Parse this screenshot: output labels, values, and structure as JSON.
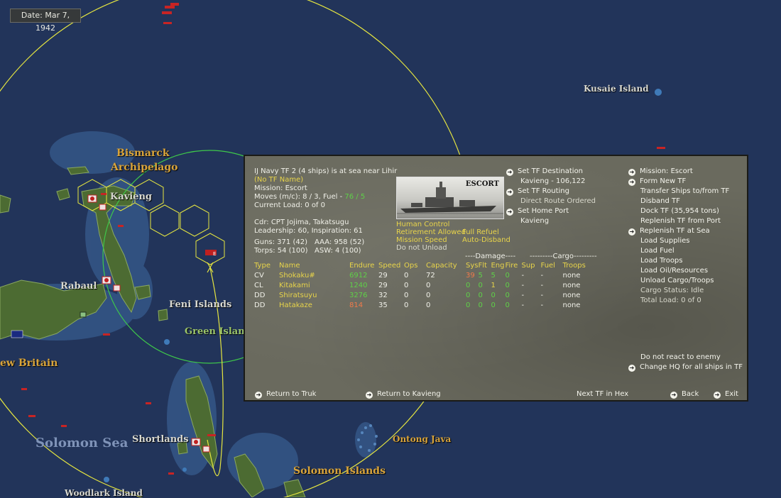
{
  "date": "Date: Mar 7, 1942",
  "map_labels": {
    "bismarck1": "Bismarck",
    "bismarck2": "Archipelago",
    "kavieng": "Kavieng",
    "rabaul": "Rabaul",
    "feni": "Feni Islands",
    "green_island": "Green Island",
    "new_britain": "ew Britain",
    "solomon_sea": "Solomon Sea",
    "shortlands": "Shortlands",
    "ontong_java": "Ontong Java",
    "solomon_islands": "Solomon Islands",
    "woodlark": "Woodlark Island",
    "kusaie": "Kusaie Island"
  },
  "tf": {
    "header": "IJ Navy TF 2 (4 ships) is at sea near Lihir",
    "tf_name": "(No TF Name)",
    "mission": "Mission: Escort",
    "moves_prefix": "Moves (m/c): 8 / 3, Fuel -",
    "moves_fuel": "76 / 5",
    "current_load": "Current Load: 0 of 0",
    "commander": "Cdr: CPT Jojima, Takatsugu",
    "leadership": "Leadership: 60, Inspiration: 61",
    "guns": "Guns: 371 (42)",
    "aaa": "AAA: 958 (52)",
    "torps": "Torps: 54 (100)",
    "asw": "ASW: 4 (100)",
    "photo_label": "ESCORT",
    "opt_human": "Human Control",
    "opt_retire": "Retirement Allowed",
    "opt_speed": "Mission Speed",
    "opt_unload": "Do not Unload",
    "opt_refuel": "Full Refuel",
    "opt_disband": "Auto-Disband"
  },
  "routing": {
    "set_destination": "Set TF Destination",
    "destination_value": "Kavieng - 106,122",
    "set_routing": "Set TF Routing",
    "routing_value": "Direct Route Ordered",
    "set_home": "Set Home Port",
    "home_value": "Kavieng"
  },
  "actions": {
    "mission": "Mission: Escort",
    "form_new": "Form New TF",
    "transfer": "Transfer Ships to/from TF",
    "disband": "Disband TF",
    "dock": "Dock TF (35,954 tons)",
    "replenish_port": "Replenish TF from Port",
    "replenish_sea": "Replenish TF at Sea",
    "load_supplies": "Load Supplies",
    "load_fuel": "Load Fuel",
    "load_troops": "Load Troops",
    "load_oil": "Load Oil/Resources",
    "unload": "Unload Cargo/Troops",
    "cargo_status": "Cargo Status: Idle",
    "total_load": "Total Load: 0 of 0",
    "no_react": "Do not react to enemy",
    "change_hq": "Change HQ for all ships in TF"
  },
  "table": {
    "damage_group": "----Damage----",
    "cargo_group": "---------Cargo---------",
    "headers": [
      "Type",
      "Name",
      "Endure",
      "Speed",
      "Ops",
      "Capacity",
      "Sys",
      "Flt",
      "Eng",
      "Fire",
      "Sup",
      "Fuel",
      "Troops"
    ],
    "rows": [
      {
        "type": "CV",
        "name": "Shokaku#",
        "endure": "6912",
        "speed": "29",
        "ops": "0",
        "capacity": "72",
        "sys": "39",
        "flt": "5",
        "eng": "5",
        "fire": "0",
        "sup": "-",
        "fuel": "-",
        "troops": "none"
      },
      {
        "type": "CL",
        "name": "Kitakami",
        "endure": "1240",
        "speed": "29",
        "ops": "0",
        "capacity": "0",
        "sys": "0",
        "flt": "0",
        "eng": "1",
        "fire": "0",
        "sup": "-",
        "fuel": "-",
        "troops": "none"
      },
      {
        "type": "DD",
        "name": "Shiratsuyu",
        "endure": "3276",
        "speed": "32",
        "ops": "0",
        "capacity": "0",
        "sys": "0",
        "flt": "0",
        "eng": "0",
        "fire": "0",
        "sup": "-",
        "fuel": "-",
        "troops": "none"
      },
      {
        "type": "DD",
        "name": "Hatakaze",
        "endure": "814",
        "speed": "35",
        "ops": "0",
        "capacity": "0",
        "sys": "0",
        "flt": "0",
        "eng": "0",
        "fire": "0",
        "sup": "-",
        "fuel": "-",
        "troops": "none"
      }
    ]
  },
  "footer": {
    "return_truk": "Return to Truk",
    "return_kavieng": "Return to Kavieng",
    "next_tf": "Next TF in Hex",
    "back": "Back",
    "exit": "Exit"
  },
  "colors": {
    "sea": "#22345a",
    "land": "#4c6b32",
    "panel": "#6a6a5e",
    "yellow_text": "#e8d44a",
    "green_text": "#5fd048",
    "orange_text": "#f07a4a"
  }
}
